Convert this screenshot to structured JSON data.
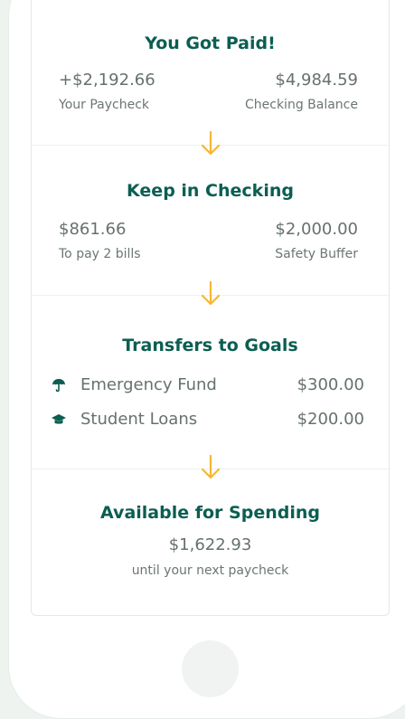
{
  "paid": {
    "title": "You Got Paid!",
    "paycheck_amount": "+$2,192.66",
    "paycheck_label": "Your Paycheck",
    "balance_amount": "$4,984.59",
    "balance_label": "Checking Balance"
  },
  "checking": {
    "title": "Keep in Checking",
    "bills_amount": "$861.66",
    "bills_label": "To pay 2 bills",
    "buffer_amount": "$2,000.00",
    "buffer_label": "Safety Buffer"
  },
  "goals": {
    "title": "Transfers to Goals",
    "items": [
      {
        "label": "Emergency Fund",
        "amount": "$300.00",
        "icon": "umbrella-icon"
      },
      {
        "label": "Student Loans",
        "amount": "$200.00",
        "icon": "graduation-cap-icon"
      }
    ]
  },
  "spending": {
    "title": "Available for Spending",
    "amount": "$1,622.93",
    "note": "until your next paycheck"
  },
  "colors": {
    "title": "#0b5e51",
    "arrow": "#f5b731",
    "text": "#66716d",
    "background": "#eef3f0"
  }
}
